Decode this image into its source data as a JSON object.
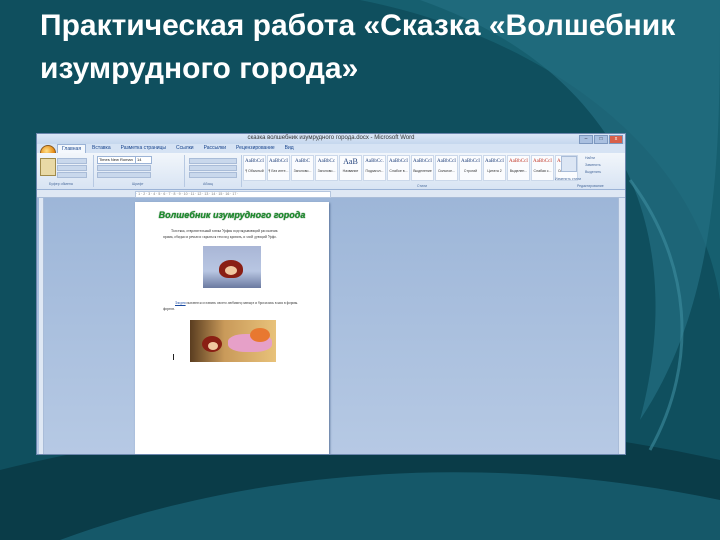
{
  "slide": {
    "title": "Практическая работа «Сказка «Волшебник изумрудного города»"
  },
  "word_window": {
    "title": "сказка волшебник изумрудного города.docx - Microsoft Word",
    "controls": [
      "–",
      "□",
      "x"
    ],
    "tabs": [
      "Главная",
      "Вставка",
      "Разметка страницы",
      "Ссылки",
      "Рассылки",
      "Рецензирование",
      "Вид"
    ],
    "font_name": "Times New Roman",
    "font_size": "14",
    "styles": [
      {
        "sample": "AaBbCcI",
        "label": "¶ Обычный"
      },
      {
        "sample": "AaBbCcI",
        "label": "¶ Без инте..."
      },
      {
        "sample": "AaBbC",
        "label": "Заголово..."
      },
      {
        "sample": "AaBbCc",
        "label": "Заголово..."
      },
      {
        "sample": "AaB",
        "label": "Название"
      },
      {
        "sample": "AaBbCc.",
        "label": "Подзагол..."
      },
      {
        "sample": "AaBbCcI",
        "label": "Слабое в..."
      },
      {
        "sample": "AaBbCcI",
        "label": "Выделение"
      },
      {
        "sample": "AaBbCcI",
        "label": "Сильное..."
      },
      {
        "sample": "AaBbCcI",
        "label": "Строгий"
      },
      {
        "sample": "AaBbCcI",
        "label": "Цитата 2"
      },
      {
        "sample": "AaBbCcI",
        "label": "Выделен..."
      },
      {
        "sample": "AaBbCcI",
        "label": "Слабая с..."
      },
      {
        "sample": "AaBbCcI",
        "label": "Сильная..."
      }
    ],
    "right_group": [
      "Найти",
      "Заменить",
      "Выделить"
    ],
    "change_styles": "Изменить стили",
    "group_labels": {
      "clipboard": "Буфер обмена",
      "font": "Шрифт",
      "paragraph": "Абзац",
      "styles": "Стили",
      "editing": "Редактирование"
    }
  },
  "document": {
    "heading": "Волшебник изумрудного города",
    "para1": "Толстяка, отвратительный злюка Урфин подглядывающий рассказчик",
    "para1b": "прима, обидно и речью и скрыться тем под кровать, и злой дующий Урфо.",
    "para2_link": "Злодеи",
    "para2": "пытаются оставить своего любимец плюнул и бросились в них в формы.",
    "para2b": "фортов."
  },
  "colors": {
    "slide_background": "#0f4f5e",
    "title_text": "#ffffff",
    "doc_heading": "#1c8c2c"
  }
}
